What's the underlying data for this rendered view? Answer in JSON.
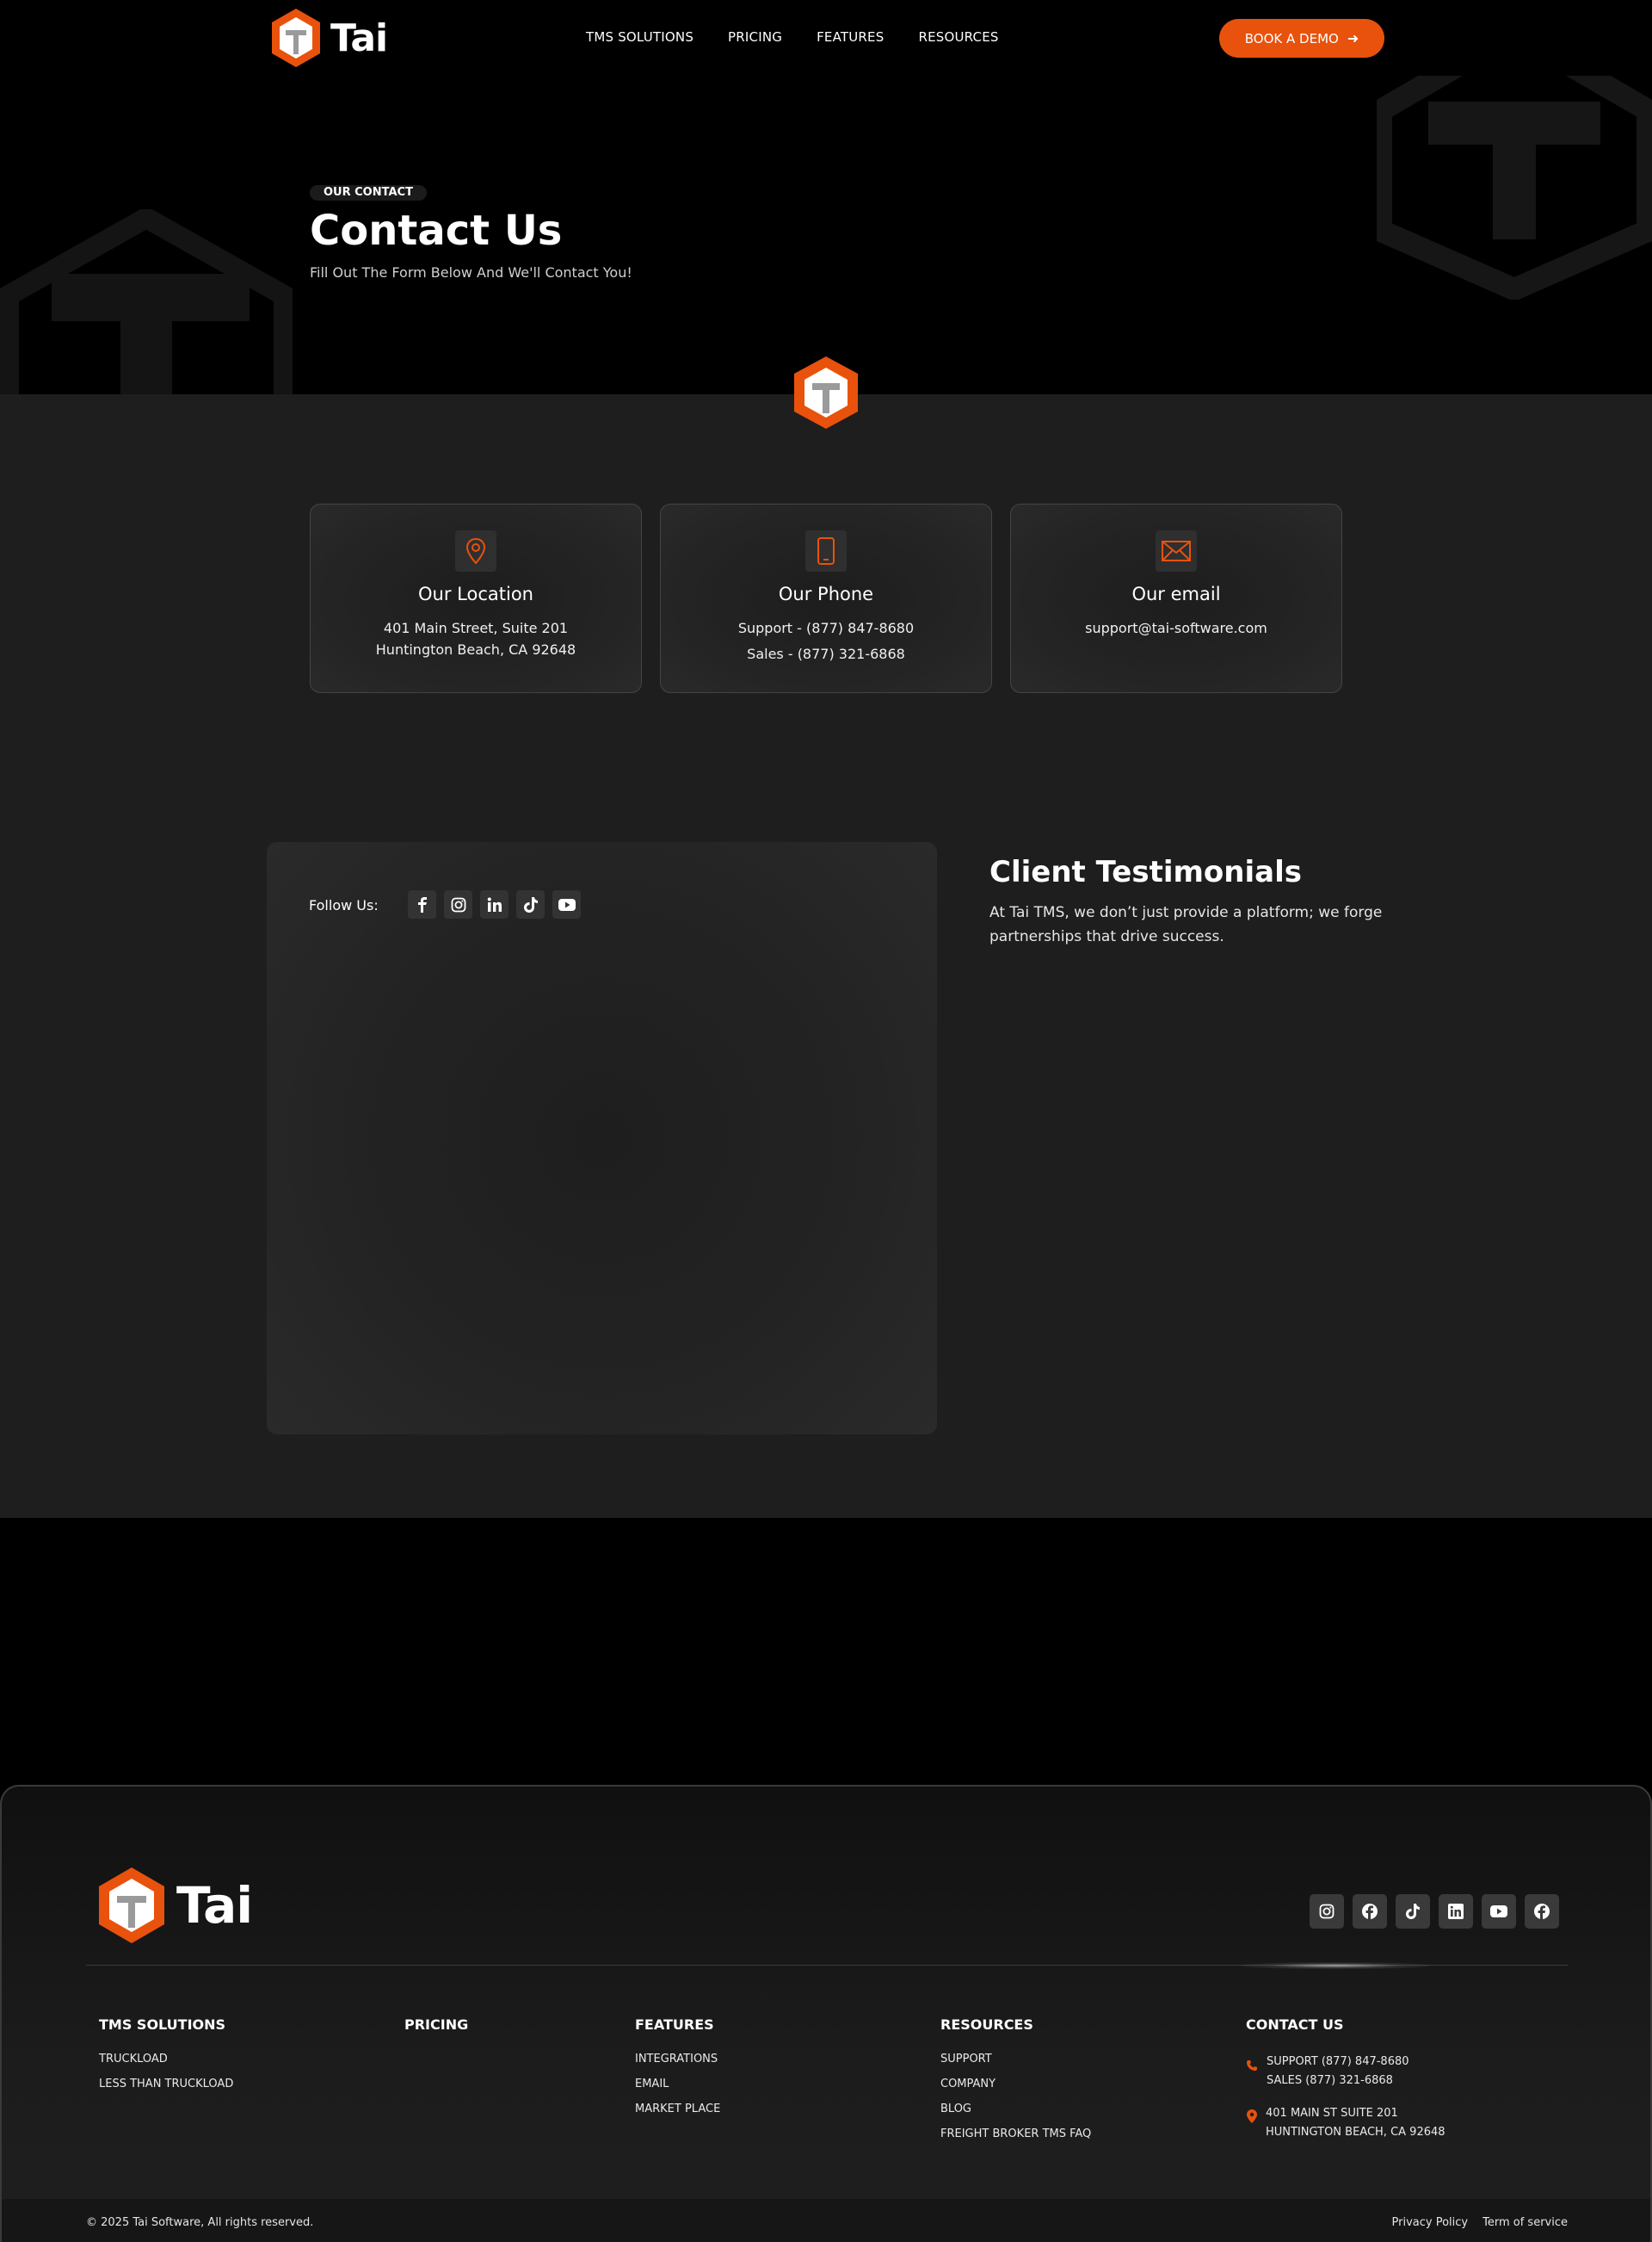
{
  "brand": {
    "name": "Tai",
    "accent": "#e8520c",
    "bg": "#000000",
    "section_bg": "#1e1e1e"
  },
  "nav": {
    "links": [
      "TMS SOLUTIONS",
      "PRICING",
      "FEATURES",
      "RESOURCES"
    ],
    "cta_label": "BOOK A DEMO",
    "cta_icon": "arrow-right-icon"
  },
  "hero": {
    "eyebrow": "OUR CONTACT",
    "title": "Contact Us",
    "subtitle": "Fill Out The Form Below And We'll Contact You!"
  },
  "cards": [
    {
      "icon": "map-pin-icon",
      "title": "Our Location",
      "lines": [
        "401 Main Street, Suite 201",
        "Huntington Beach, CA 92648"
      ]
    },
    {
      "icon": "phone-icon",
      "title": "Our Phone",
      "lines": [
        "Support - (877) 847-8680",
        "Sales - (877) 321-6868"
      ]
    },
    {
      "icon": "mail-icon",
      "title": "Our email",
      "lines": [
        "support@tai-software.com"
      ]
    }
  ],
  "follow": {
    "label": "Follow Us:",
    "icons": [
      "facebook-icon",
      "instagram-icon",
      "linkedin-icon",
      "tiktok-icon",
      "youtube-icon"
    ]
  },
  "testimonials": {
    "title": "Client Testimonials",
    "body": "At Tai TMS, we don’t just provide a platform; we forge partnerships that drive success."
  },
  "footer": {
    "social_icons": [
      "instagram-icon",
      "facebook-icon",
      "tiktok-icon",
      "linkedin-icon",
      "youtube-icon",
      "facebook-icon"
    ],
    "columns": {
      "tms": {
        "head": "TMS SOLUTIONS",
        "items": [
          "TRUCKLOAD",
          "LESS THAN TRUCKLOAD"
        ]
      },
      "pricing": {
        "head": "PRICING",
        "items": []
      },
      "features": {
        "head": "FEATURES",
        "items": [
          "INTEGRATIONS",
          "EMAIL",
          "MARKET PLACE"
        ]
      },
      "resources": {
        "head": "RESOURCES",
        "items": [
          "SUPPORT",
          "COMPANY",
          "BLOG",
          "FREIGHT BROKER TMS FAQ"
        ]
      },
      "contact": {
        "head": "CONTACT US",
        "phone_lines": [
          "SUPPORT (877) 847-8680",
          "SALES (877) 321-6868"
        ],
        "address_lines": [
          "401 MAIN ST SUITE 201",
          "HUNTINGTON BEACH, CA 92648"
        ]
      }
    },
    "copyright": "© 2025 Tai Software, All rights reserved.",
    "legal": [
      "Privacy Policy",
      "Term of service"
    ]
  }
}
